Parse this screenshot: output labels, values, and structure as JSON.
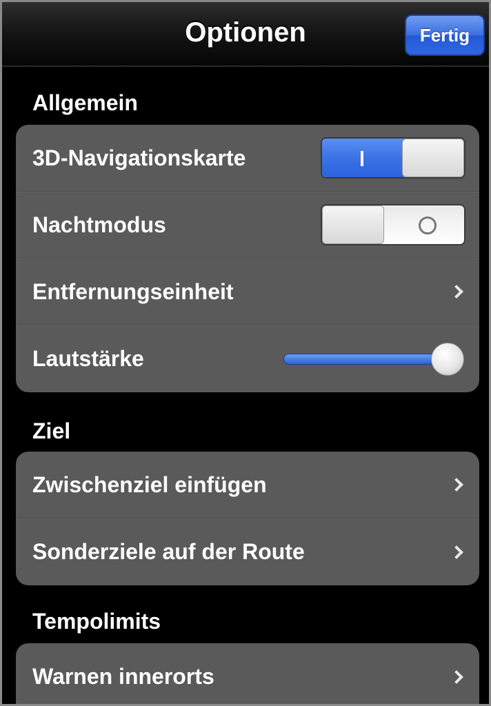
{
  "navbar": {
    "title": "Optionen",
    "done_label": "Fertig"
  },
  "sections": {
    "general": {
      "header": "Allgemein",
      "nav3d_label": "3D-Navigationskarte",
      "nav3d_on": true,
      "night_label": "Nachtmodus",
      "night_on": false,
      "distance_label": "Entfernungseinheit",
      "volume_label": "Lautstärke",
      "volume_level": 1.0
    },
    "destination": {
      "header": "Ziel",
      "waypoint_label": "Zwischenziel einfügen",
      "poi_label": "Sonderziele auf der Route"
    },
    "speed": {
      "header": "Tempolimits",
      "warn_urban_label": "Warnen innerorts"
    }
  },
  "colors": {
    "accent": "#3a72e6",
    "cell_bg": "#5a5a5a",
    "background": "#000000"
  },
  "icons": {
    "chevron": "chevron-right-icon"
  }
}
